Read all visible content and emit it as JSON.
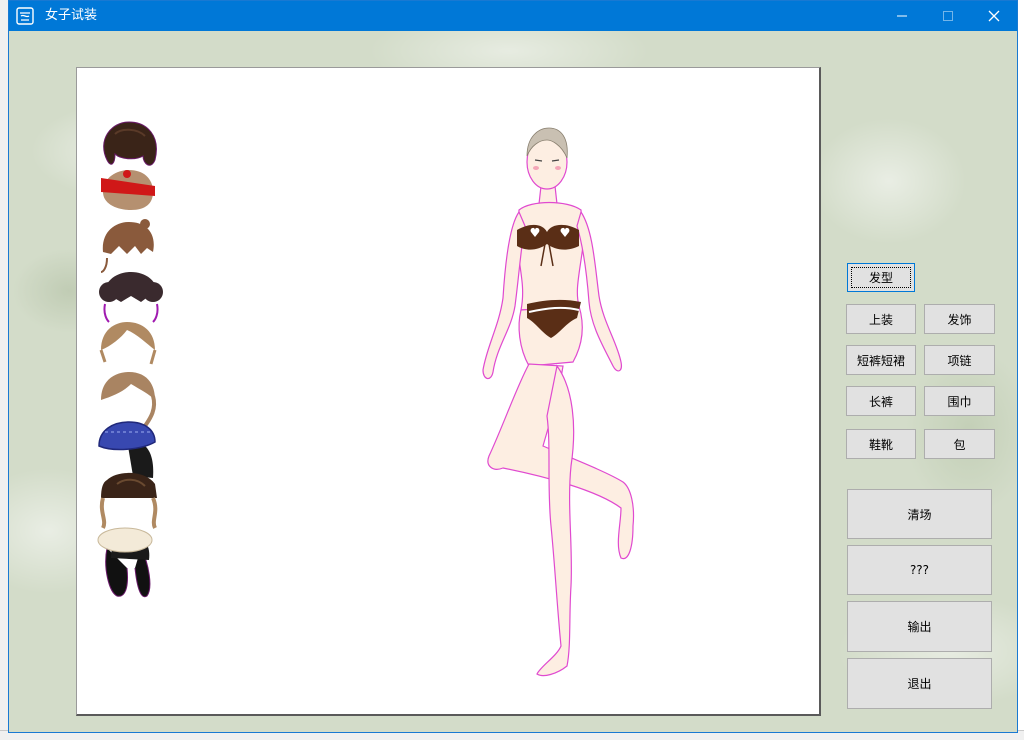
{
  "window": {
    "title": "女子试装",
    "minimize_glyph": "—",
    "close_glyph": "✕"
  },
  "colors": {
    "titlebar": "#0078d7",
    "canvas_bg": "#ffffff",
    "client_bg": "#d3dcc9",
    "button_face": "#e1e1e1"
  },
  "hair_styles": [
    {
      "name": "dark-brown-wavy",
      "color": "#3a2418"
    },
    {
      "name": "red-bandana",
      "color": "#c81a1a"
    },
    {
      "name": "brown-bangs",
      "color": "#8a5a3c"
    },
    {
      "name": "dark-curly-buns",
      "color": "#3a2a2e"
    },
    {
      "name": "light-brown-side",
      "color": "#b08a62"
    },
    {
      "name": "light-brown-wavy",
      "color": "#a98462"
    },
    {
      "name": "blue-knit-hat",
      "color": "#3040a0"
    },
    {
      "name": "brown-hat",
      "color": "#4a3020"
    },
    {
      "name": "white-beret-black",
      "color": "#1a1a1a"
    }
  ],
  "buttons": {
    "hairstyle": "发型",
    "top": "上装",
    "hair_accessory": "发饰",
    "shorts_skirt": "短裤短裙",
    "necklace": "项链",
    "pants": "长裤",
    "scarf": "围巾",
    "shoes": "鞋靴",
    "bag": "包",
    "clear": "清场",
    "unknown": "???",
    "export": "输出",
    "exit": "退出"
  }
}
